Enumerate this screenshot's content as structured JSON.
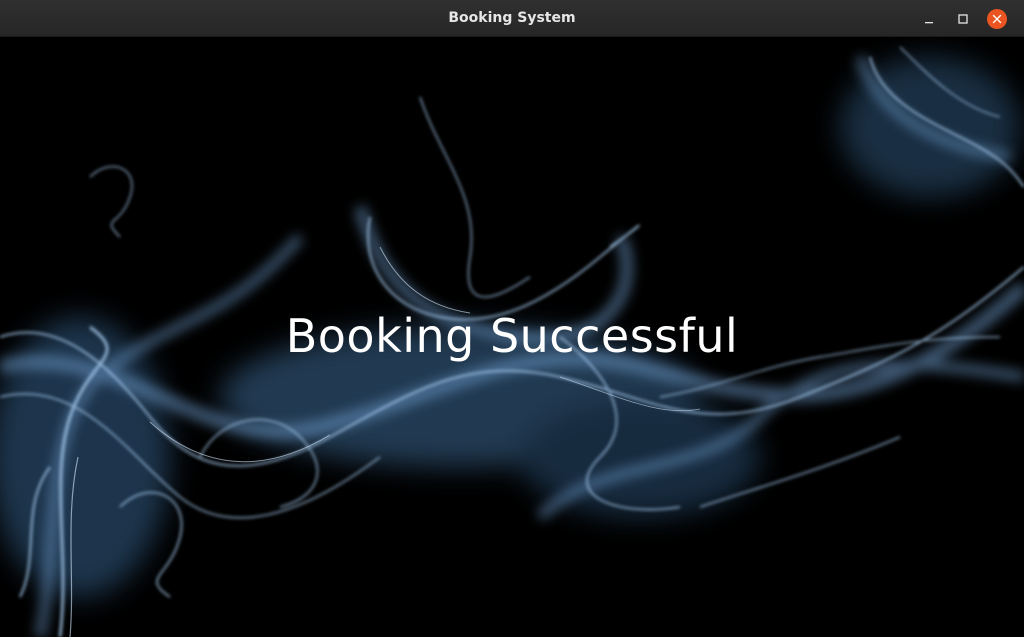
{
  "window": {
    "title": "Booking System"
  },
  "controls": {
    "minimize_icon": "minimize-icon",
    "maximize_icon": "maximize-icon",
    "close_icon": "close-icon",
    "close_color": "#e95420"
  },
  "main": {
    "message": "Booking Successful",
    "background": "smoke-image"
  }
}
